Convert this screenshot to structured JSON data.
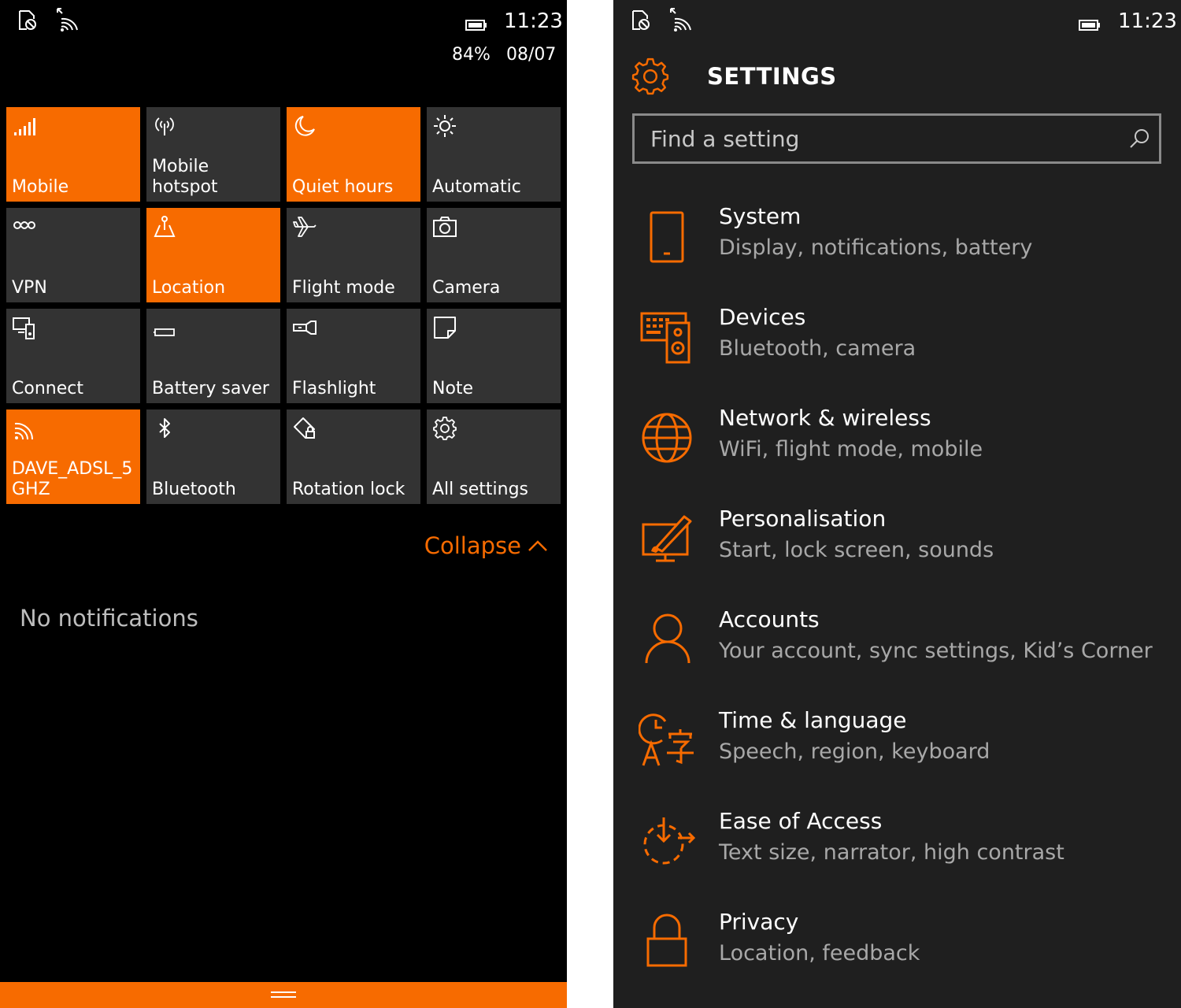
{
  "left_phone": {
    "status": {
      "time": "11:23",
      "battery_percent": "84%",
      "date": "08/07"
    },
    "tiles": [
      {
        "label": "Mobile",
        "icon": "signal-bars-icon",
        "active": true
      },
      {
        "label": "Mobile\nhotspot",
        "icon": "hotspot-icon",
        "active": false
      },
      {
        "label": "Quiet hours",
        "icon": "moon-icon",
        "active": true
      },
      {
        "label": "Automatic",
        "icon": "brightness-icon",
        "active": false
      },
      {
        "label": "VPN",
        "icon": "vpn-icon",
        "active": false
      },
      {
        "label": "Location",
        "icon": "location-icon",
        "active": true
      },
      {
        "label": "Flight mode",
        "icon": "airplane-icon",
        "active": false
      },
      {
        "label": "Camera",
        "icon": "camera-icon",
        "active": false
      },
      {
        "label": "Connect",
        "icon": "connect-icon",
        "active": false
      },
      {
        "label": "Battery saver",
        "icon": "battery-saver-icon",
        "active": false
      },
      {
        "label": "Flashlight",
        "icon": "flashlight-icon",
        "active": false
      },
      {
        "label": "Note",
        "icon": "note-icon",
        "active": false
      },
      {
        "label": "DAVE_ADSL_5\nGHZ",
        "icon": "wifi-icon",
        "active": true
      },
      {
        "label": "Bluetooth",
        "icon": "bluetooth-icon",
        "active": false
      },
      {
        "label": "Rotation lock",
        "icon": "rotation-lock-icon",
        "active": false
      },
      {
        "label": "All settings",
        "icon": "gear-icon",
        "active": false
      }
    ],
    "collapse_label": "Collapse",
    "no_notifications": "No notifications"
  },
  "right_phone": {
    "status": {
      "time": "11:23"
    },
    "title": "SETTINGS",
    "search": {
      "placeholder": "Find a setting",
      "value": ""
    },
    "categories": [
      {
        "title": "System",
        "subtitle": "Display, notifications, battery",
        "icon": "phone-device-icon"
      },
      {
        "title": "Devices",
        "subtitle": "Bluetooth, camera",
        "icon": "devices-icon"
      },
      {
        "title": "Network & wireless",
        "subtitle": "WiFi, flight mode, mobile",
        "icon": "globe-icon"
      },
      {
        "title": "Personalisation",
        "subtitle": "Start, lock screen, sounds",
        "icon": "personalisation-icon"
      },
      {
        "title": "Accounts",
        "subtitle": "Your account, sync settings, Kid’s Corner",
        "icon": "person-icon"
      },
      {
        "title": "Time & language",
        "subtitle": "Speech, region, keyboard",
        "icon": "time-language-icon"
      },
      {
        "title": "Ease of Access",
        "subtitle": "Text size, narrator, high contrast",
        "icon": "ease-of-access-icon"
      },
      {
        "title": "Privacy",
        "subtitle": "Location, feedback",
        "icon": "lock-icon"
      }
    ]
  },
  "colors": {
    "accent": "#f76b00",
    "tile_off": "#333333",
    "left_bg": "#000000",
    "right_bg": "#1f1f1f",
    "subtitle": "#a8a8a8"
  }
}
